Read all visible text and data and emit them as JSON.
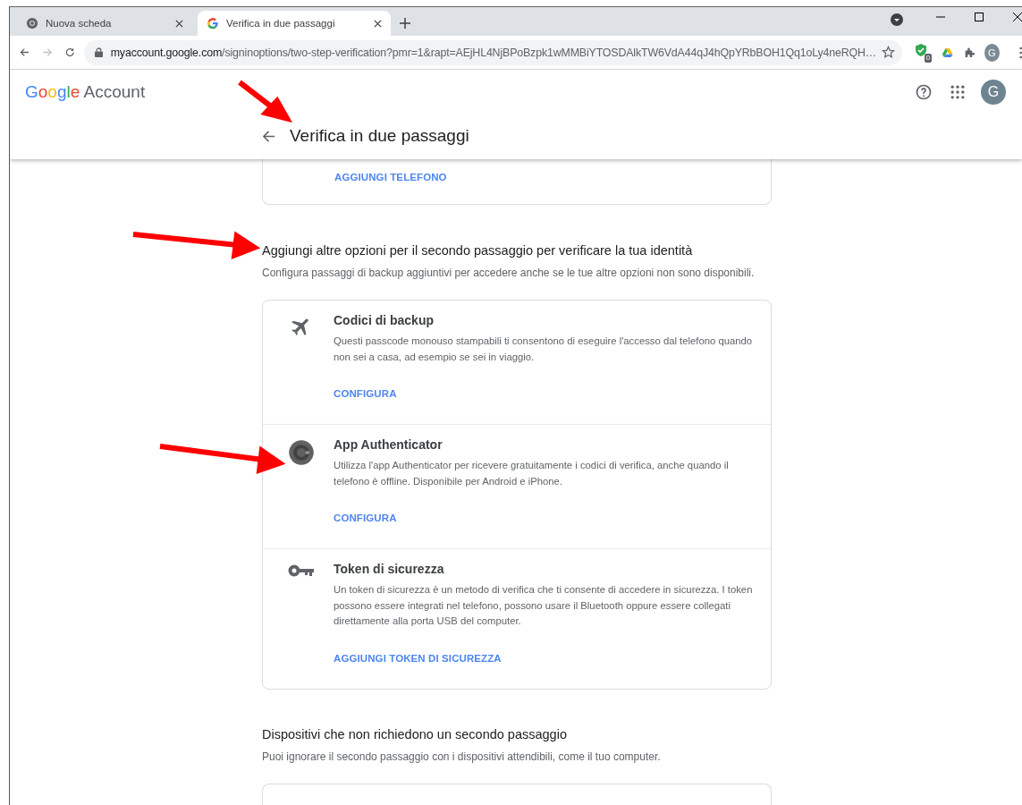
{
  "browser": {
    "tabs": [
      {
        "kind": "chrome",
        "title": "Nuova scheda",
        "selected": false
      },
      {
        "kind": "google",
        "title": "Verifica in due passaggi",
        "selected": true
      }
    ],
    "url": {
      "host": "myaccount.google.com",
      "path": "/signinoptions/two-step-verification?pmr=1&rapt=AEjHL4NjBPoBzpk1wMMBiYTOSDAlkTW6VdA44qJ4hQpYRbBOH1Qq1oLy4neRQH…"
    },
    "extension_badge": "0",
    "profile": "G"
  },
  "header": {
    "logo_google": "Google",
    "logo_account": "Account",
    "avatar": "G",
    "title": "Verifica in due passaggi"
  },
  "phone_card": {
    "link": "AGGIUNGI TELEFONO"
  },
  "more_options": {
    "heading": "Aggiungi altre opzioni per il secondo passaggio per verificare la tua identità",
    "description": "Configura passaggi di backup aggiuntivi per accedere anche se le tue altre opzioni non sono disponibili.",
    "options": [
      {
        "kind": "plane",
        "title": "Codici di backup",
        "description": "Questi passcode monouso stampabili ti consentono di eseguire l'accesso dal telefono quando non sei a casa, ad esempio se sei in viaggio.",
        "link": "CONFIGURA"
      },
      {
        "kind": "authenticator",
        "title": "App Authenticator",
        "description": "Utilizza l'app Authenticator per ricevere gratuitamente i codici di verifica, anche quando il telefono è offline. Disponibile per Android e iPhone.",
        "link": "CONFIGURA"
      },
      {
        "kind": "key",
        "title": "Token di sicurezza",
        "description": "Un token di sicurezza è un metodo di verifica che ti consente di accedere in sicurezza. I token possono essere integrati nel telefono, possono usare il Bluetooth oppure essere collegati direttamente alla porta USB del computer.",
        "link": "AGGIUNGI TOKEN DI SICUREZZA"
      }
    ]
  },
  "devices": {
    "heading": "Dispositivi che non richiedono un secondo passaggio",
    "description": "Puoi ignorare il secondo passaggio con i dispositivi attendibili, come il tuo computer."
  }
}
